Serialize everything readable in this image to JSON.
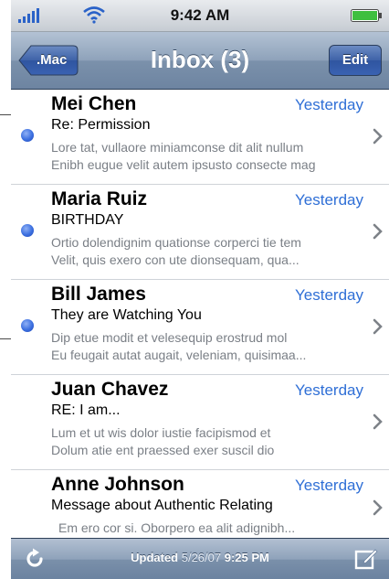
{
  "status_bar": {
    "time": "9:42 AM",
    "icons": [
      "signal-icon",
      "wifi-icon",
      "battery-icon"
    ]
  },
  "nav": {
    "back_label": ".Mac",
    "title": "Inbox (3)",
    "edit_label": "Edit"
  },
  "messages": [
    {
      "sender": "Mei Chen",
      "date": "Yesterday",
      "subject": "Re: Permission",
      "preview_line1": "Lore tat, vullaore miniamconse dit alit nullum",
      "preview_line2": "Enibh eugue velit autem ipsusto consecte mag",
      "unread": true
    },
    {
      "sender": "Maria Ruiz",
      "date": "Yesterday",
      "subject": "BIRTHDAY",
      "preview_line1": "Ortio dolendignim quationse corperci tie tem",
      "preview_line2": "Velit, quis exero con ute dionsequam, qua...",
      "unread": true
    },
    {
      "sender": "Bill James",
      "date": "Yesterday",
      "subject": "They are Watching You",
      "preview_line1": "Dip etue modit et velesequip erostrud mol",
      "preview_line2": "Eu feugait autat augait, veleniam, quisimaa...",
      "unread": true
    },
    {
      "sender": "Juan Chavez",
      "date": "Yesterday",
      "subject": "RE: I am...",
      "preview_line1": "Lum et ut wis dolor iustie facipismod et",
      "preview_line2": "Dolum atie ent praessed exer suscil dio",
      "unread": false
    },
    {
      "sender": "Anne Johnson",
      "date": "Yesterday",
      "subject": "Message about Authentic Relating",
      "preview_line1": "Em ero cor si. Oborpero ea alit adignibh...",
      "preview_line2": "",
      "unread": false
    }
  ],
  "toolbar": {
    "updated_label": "Updated",
    "updated_date": "5/26/07",
    "updated_time": "9:25 PM",
    "icons": [
      "refresh-icon",
      "compose-icon"
    ]
  },
  "colors": {
    "accent_blue": "#2f6fd6",
    "unread_dot": "#3b6fe0",
    "nav_bar": "#8ea2ba",
    "edit_button": "#3e62a8"
  }
}
